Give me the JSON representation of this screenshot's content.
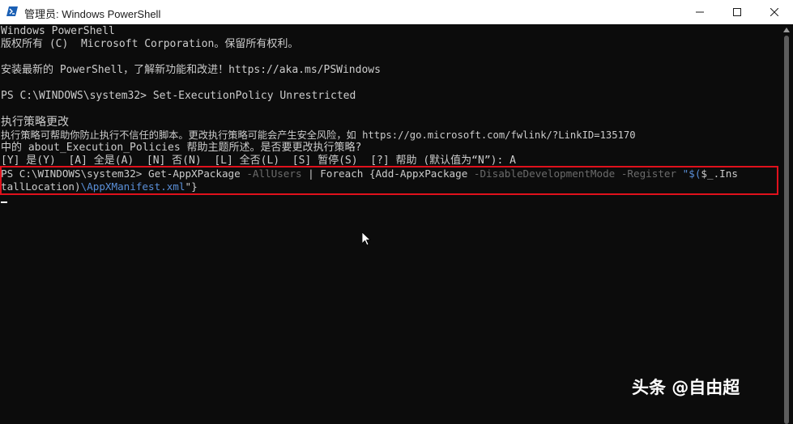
{
  "window": {
    "title": "管理员: Windows PowerShell",
    "controls": [
      "minimize",
      "maximize",
      "close"
    ]
  },
  "console": {
    "lines": [
      "Windows PowerShell",
      "版权所有 (C)  Microsoft Corporation。保留所有权利。",
      "",
      "安装最新的 PowerShell，了解新功能和改进！https://aka.ms/PSWindows",
      "",
      "PS C:\\WINDOWS\\system32> Set-ExecutionPolicy Unrestricted",
      "",
      "执行策略更改",
      "执行策略可帮助你防止执行不信任的脚本。更改执行策略可能会产生安全风险，如 https://go.microsoft.com/fwlink/?LinkID=135170",
      "中的 about_Execution_Policies 帮助主题所述。是否要更改执行策略?",
      "[Y] 是(Y)  [A] 全是(A)  [N] 否(N)  [L] 全否(L)  [S] 暂停(S)  [?] 帮助 (默认值为“N”): A"
    ],
    "command": {
      "prompt": "PS C:\\WINDOWS\\system32> ",
      "cmd1": "Get-AppXPackage ",
      "param1": "-AllUsers",
      "pipe": " | Foreach {Add-AppxPackage ",
      "param2": "-DisableDevelopmentMode -Register ",
      "str1": "\"$(",
      "var1": "$_",
      "str2": ".Ins",
      "line2_a": "tallLocation)",
      "line2_str": "\\AppXManifest.xml",
      "line2_quote": "\"",
      "line2_end": "}"
    }
  },
  "watermark": "头条 @自由超",
  "colors": {
    "background": "#0c0c0c",
    "text": "#cccccc",
    "highlight_border": "#e0111c",
    "param": "#6b6b6b",
    "string": "#5a8fd8"
  }
}
